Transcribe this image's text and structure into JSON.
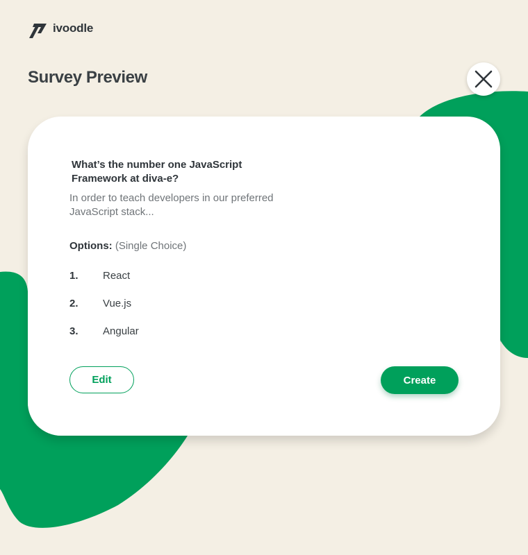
{
  "brand": {
    "name": "ivoodle",
    "logo_icon": "ivoodle-logo-icon"
  },
  "header": {
    "title": "Survey Preview",
    "close_icon": "close-icon"
  },
  "survey": {
    "question": "What’s the number one JavaScript Framework at diva-e?",
    "description": "In order to teach developers in our preferred JavaScript stack...",
    "options_label": "Options:",
    "options_type": "(Single Choice)",
    "options": [
      {
        "number": "1.",
        "label": "React"
      },
      {
        "number": "2.",
        "label": "Vue.js"
      },
      {
        "number": "3.",
        "label": "Angular"
      }
    ]
  },
  "actions": {
    "edit_label": "Edit",
    "create_label": "Create"
  },
  "colors": {
    "background": "#f4efe4",
    "accent": "#00a05b",
    "accent_light": "#8ed4b0",
    "text_dark": "#2f353a",
    "text_muted": "#6f7478",
    "card": "#ffffff"
  }
}
